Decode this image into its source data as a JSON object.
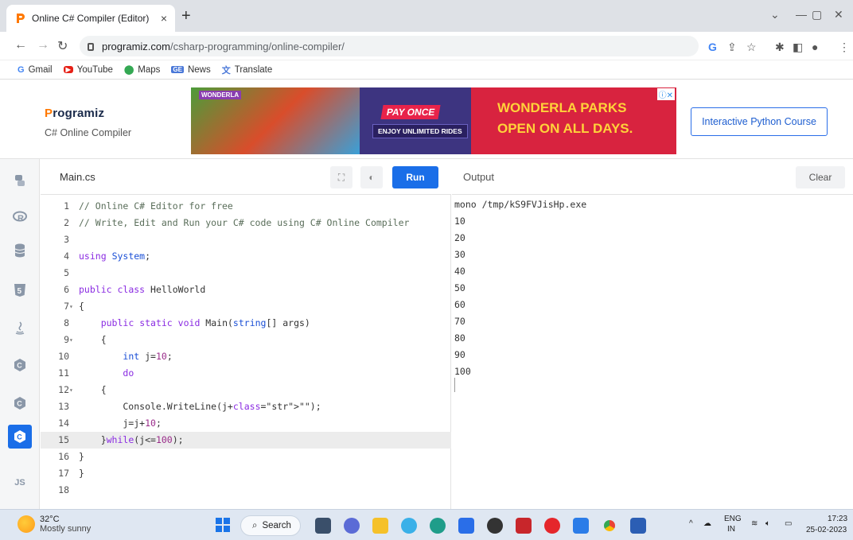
{
  "browser": {
    "tab_title": "Online C# Compiler (Editor)",
    "tab_close": "×",
    "new_tab": "+",
    "url_host": "programiz.com",
    "url_path": "/csharp-programming/online-compiler/",
    "bookmarks": [
      "Gmail",
      "YouTube",
      "Maps",
      "News",
      "Translate"
    ]
  },
  "site": {
    "logo_first": "P",
    "logo_rest": "rogramiz",
    "subtitle": "C# Online Compiler",
    "ad": {
      "pay_once": "PAY ONCE",
      "unlimited": "ENJOY UNLIMITED RIDES",
      "headline_1": "WONDERLA PARKS",
      "headline_2": "OPEN ON ALL DAYS.",
      "brand": "WONDERLA"
    },
    "course_button": "Interactive Python Course"
  },
  "sidebar": {
    "items": [
      "python-icon",
      "r-icon",
      "sql-icon",
      "html-icon",
      "java-icon",
      "c-icon",
      "cpp-icon",
      "csharp-icon",
      "js-icon"
    ],
    "js_label": "JS",
    "active_index": 7
  },
  "editor": {
    "filename": "Main.cs",
    "run_label": "Run",
    "lines": [
      {
        "n": "1",
        "text": "// Online C# Editor for free"
      },
      {
        "n": "2",
        "text": "// Write, Edit and Run your C# code using C# Online Compiler"
      },
      {
        "n": "3",
        "text": ""
      },
      {
        "n": "4",
        "text": "using System;"
      },
      {
        "n": "5",
        "text": ""
      },
      {
        "n": "6",
        "text": "public class HelloWorld"
      },
      {
        "n": "7",
        "text": "{"
      },
      {
        "n": "8",
        "text": "    public static void Main(string[] args)"
      },
      {
        "n": "9",
        "text": "    {"
      },
      {
        "n": "10",
        "text": "        int j=10;"
      },
      {
        "n": "11",
        "text": "        do"
      },
      {
        "n": "12",
        "text": "    {"
      },
      {
        "n": "13",
        "text": "        Console.WriteLine(j+\"\");"
      },
      {
        "n": "14",
        "text": "        j=j+10;"
      },
      {
        "n": "15",
        "text": "    }while(j<=100);"
      },
      {
        "n": "16",
        "text": "}"
      },
      {
        "n": "17",
        "text": "}"
      },
      {
        "n": "18",
        "text": ""
      }
    ]
  },
  "output": {
    "label": "Output",
    "clear_label": "Clear",
    "lines": [
      "mono /tmp/kS9FVJisHp.exe",
      "10",
      "20",
      "30",
      "40",
      "50",
      "60",
      "70",
      "80",
      "90",
      "100"
    ]
  },
  "taskbar": {
    "temperature": "32°C",
    "weather": "Mostly sunny",
    "search": "Search",
    "lang_1": "ENG",
    "lang_2": "IN",
    "time": "17:23",
    "date": "25-02-2023"
  },
  "colors": {
    "accent": "#1a6ee8",
    "logo_orange": "#ff7800",
    "ad_red": "#d8233f",
    "ad_yellow": "#ffd23a"
  }
}
